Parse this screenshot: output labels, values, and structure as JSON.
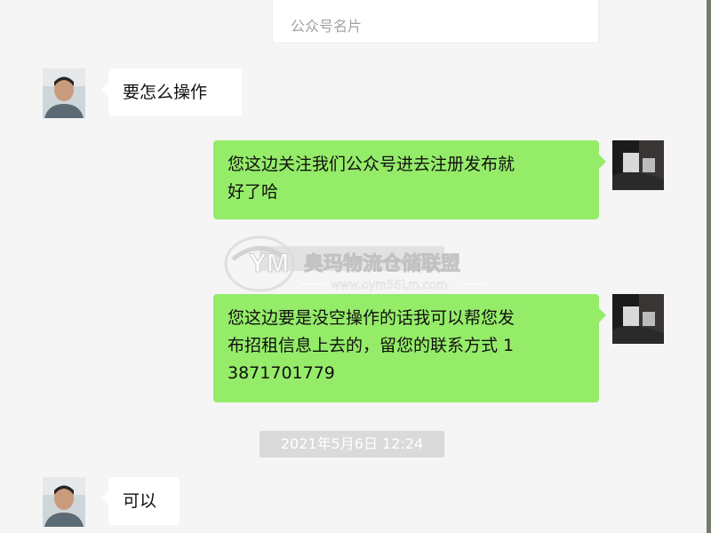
{
  "card": {
    "label": "公众号名片"
  },
  "messages": [
    {
      "side": "left",
      "text": "要怎么操作"
    },
    {
      "side": "right",
      "line1": "您这边关注我们公众号进去注册发布就",
      "line2": "好了哈"
    },
    {
      "side": "right",
      "line1": "您这边要是没空操作的话我可以帮您发",
      "line2": "布招租信息上去的，留您的联系方式 1",
      "line3": "3871701779"
    },
    {
      "side": "left",
      "text": "可以"
    }
  ],
  "timestamp": "2021年5月6日 12:24",
  "watermark": {
    "logo": "YM",
    "name": "奥玛物流仓储联盟",
    "url": "www.oym56Lm.com"
  },
  "colors": {
    "background": "#f5f5f5",
    "sent_bubble": "#95ec69",
    "received_bubble": "#ffffff",
    "timestamp_bg": "#dadada"
  },
  "icons": {
    "contact_avatar": "avatar-icon",
    "own_avatar": "avatar-icon"
  }
}
